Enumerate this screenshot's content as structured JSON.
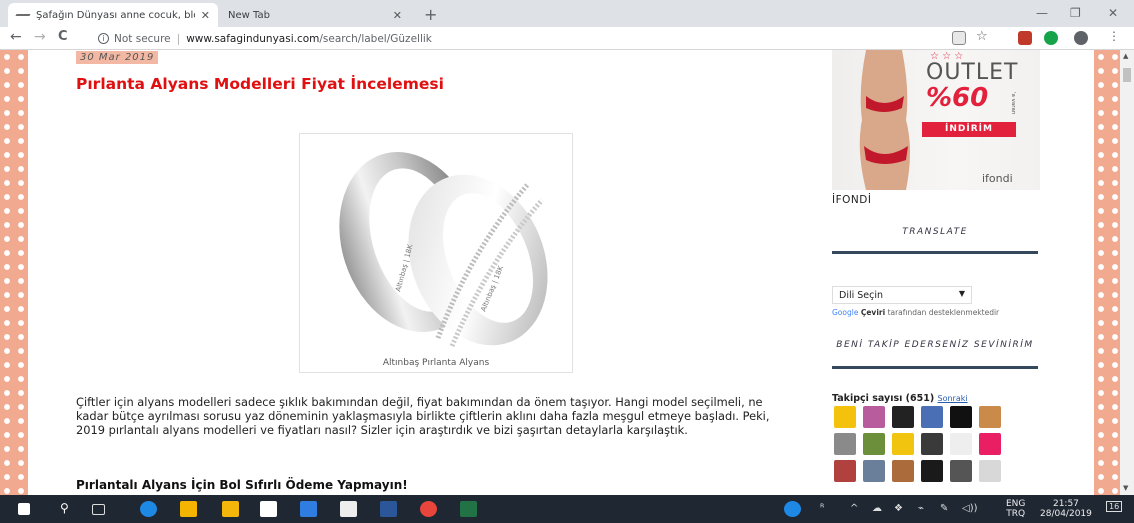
{
  "browser": {
    "tabs": [
      {
        "title": "Şafağın Dünyası anne cocuk, blo",
        "close": "✕"
      },
      {
        "title": "New Tab",
        "close": "✕"
      }
    ],
    "new_tab": "+",
    "window_controls": [
      "—",
      "❐",
      "✕"
    ],
    "nav": {
      "back": "←",
      "forward": "→",
      "reload": "C"
    },
    "url": {
      "security": "Not secure",
      "host": "www.safagindunyasi.com",
      "path": "/search/label/Güzellik"
    }
  },
  "post": {
    "date": "30 Mar 2019",
    "title": "Pırlanta Alyans Modelleri Fiyat İncelemesi",
    "image_caption": "Altınbaş Pırlanta Alyans",
    "ring_engraving": "Altınbaş | 18K",
    "paragraph": "Çiftler için alyans modelleri sadece şıklık bakımından değil, fiyat bakımından da önem taşıyor. Hangi model seçilmeli, ne kadar bütçe ayrılması sorusu yaz döneminin yaklaşmasıyla birlikte çiftlerin aklını daha fazla meşgul etmeye başladı. Peki, 2019 pırlantalı alyans modelleri ve fiyatları nasıl? Sizler için araştırdık ve bizi şaşırtan detaylarla karşılaştık.",
    "subheading": "Pırlantalı Alyans İçin Bol Sıfırlı Ödeme Yapmayın!"
  },
  "sidebar": {
    "ad": {
      "outlet": "OUTLET",
      "discount": "%60",
      "ya_varan": "'a varan",
      "button": "İNDİRİM",
      "brand": "ifondi"
    },
    "ad_label": "İFONDİ",
    "translate_heading": "TRANSLATE",
    "language_select": "Dili Seçin",
    "powered_google": "Google",
    "powered_ceviri": "Çeviri",
    "powered_rest": "tarafından desteklenmektedir",
    "follow_heading": "BENİ TAKİP EDERSENİZ SEVİNİRİM",
    "followers_label": "Takipçi sayısı (651)",
    "followers_next": "Sonraki",
    "avatar_colors": [
      "#f4c20d",
      "#b85c9e",
      "#222222",
      "#4a6fb5",
      "#111111",
      "#c98a4a",
      "#8a8a8a",
      "#6b8f3a",
      "#f1c40f",
      "#3a3a3a",
      "#eeeeee",
      "#e91e63",
      "#b0413e",
      "#6a7f99",
      "#ab6b3b",
      "#1a1a1a",
      "#555555",
      "#d8d8d8"
    ]
  },
  "taskbar": {
    "language_top": "ENG",
    "language_bottom": "TRQ",
    "time": "21:57",
    "date": "28/04/2019",
    "notifications": "16"
  }
}
